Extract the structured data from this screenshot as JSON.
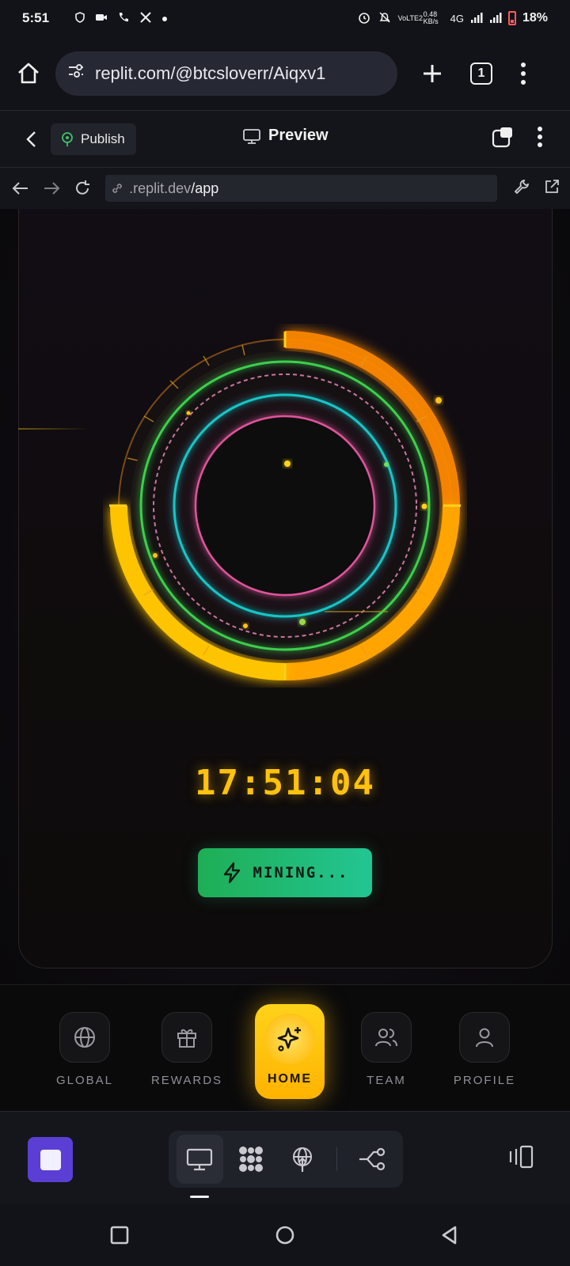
{
  "status_bar": {
    "time": "5:51",
    "network": "4G",
    "data_rate": "0.48 KB/s",
    "volte": "VoLTE2",
    "battery": "18%"
  },
  "browser": {
    "url": "replit.com/@btcsloverr/Aiqxv1",
    "tab_count": "1"
  },
  "replit_header": {
    "publish_label": "Publish",
    "title": "Preview"
  },
  "webview": {
    "address_prefix": ".replit.dev",
    "address_path": "/app"
  },
  "app": {
    "timer": "17:51:04",
    "mining_label": "MINING...",
    "colors": {
      "gold": "#ffc20e",
      "orange": "#ff8a00",
      "green": "#3ccf4e",
      "cyan": "#19c6c6",
      "pink": "#e0559c",
      "button_green": "#22c580"
    }
  },
  "tabs": [
    {
      "label": "GLOBAL",
      "icon": "globe-icon"
    },
    {
      "label": "REWARDS",
      "icon": "gift-icon"
    },
    {
      "label": "HOME",
      "icon": "sparkles-icon",
      "active": true
    },
    {
      "label": "TEAM",
      "icon": "users-icon"
    },
    {
      "label": "PROFILE",
      "icon": "user-icon"
    }
  ],
  "replit_toolbar": {
    "tools": [
      "monitor-icon",
      "packages-icon",
      "deploy-icon",
      "workflow-icon"
    ],
    "active_tool": "monitor-icon"
  }
}
